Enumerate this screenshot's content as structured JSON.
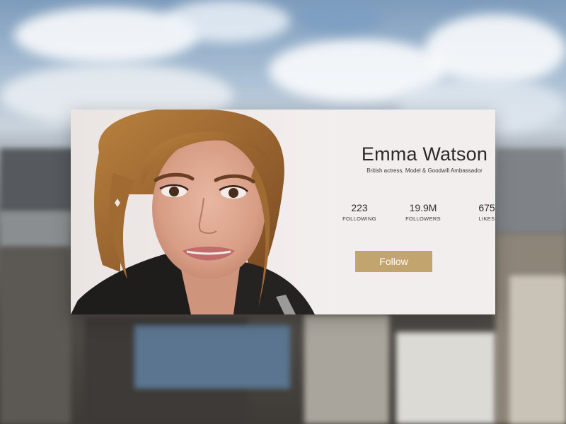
{
  "profile": {
    "name": "Emma Watson",
    "subtitle": "British actress, Model & Goodwill Ambassador",
    "photo_alt": "portrait photo"
  },
  "stats": [
    {
      "value": "223",
      "label": "FOLLOWING"
    },
    {
      "value": "19.9M",
      "label": "FOLLOWERS"
    },
    {
      "value": "675",
      "label": "LIKES"
    }
  ],
  "actions": {
    "follow_label": "Follow"
  },
  "colors": {
    "card_background": "#f3eeee",
    "accent": "#c2a56e",
    "text": "#2e2a29"
  }
}
